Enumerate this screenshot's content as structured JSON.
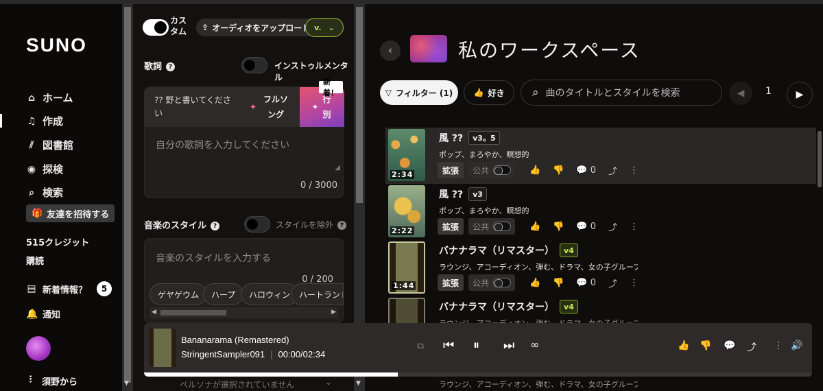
{
  "sidebar": {
    "logo": "SUNO",
    "items": [
      {
        "label": "ホーム",
        "icon": "home-icon"
      },
      {
        "label": "作成",
        "icon": "music-note-icon"
      },
      {
        "label": "図書館",
        "icon": "library-icon"
      },
      {
        "label": "探検",
        "icon": "compass-icon"
      },
      {
        "label": "検索",
        "icon": "search-icon"
      }
    ],
    "invite": "友達を招待する",
    "credits": "515クレジット",
    "subscribe": "購読",
    "news": "新着情報？",
    "news_count": "5",
    "notifications": "通知",
    "account": "須野から"
  },
  "create": {
    "custom_label": "カスタム",
    "upload_label": "オーディオをアップロード",
    "version_label": "v.",
    "lyrics_label": "歌詞",
    "instrumental_label": "インストゥルメンタル",
    "lyrics_prompt": "?? 野と書いてください",
    "full_song": "フルソング",
    "line_by_line": "行別",
    "new_tag": "新着！",
    "lyrics_placeholder": "自分の歌詞を入力してください",
    "lyrics_count": "0 / 3000",
    "style_label": "音楽のスタイル",
    "exclude_label": "スタイルを除外",
    "style_placeholder": "音楽のスタイルを入力する",
    "style_count": "0 / 200",
    "chips": [
      "ゲヤゲウム",
      "ハープ",
      "ハロウィン",
      "ハートランドI"
    ],
    "persona_placeholder": "ペルソナが選択されていません"
  },
  "workspace": {
    "title": "私のワークスペース",
    "filter": "フィルター (1)",
    "like": "好き",
    "search_placeholder": "曲のタイトルとスタイルを検索",
    "page": "1",
    "songs": [
      {
        "title": "風 ??",
        "version": "v3。5",
        "tags": "ポップ、まろやか、瞑想的",
        "duration": "2:34",
        "extend": "拡張",
        "public": "公共",
        "comments": "0"
      },
      {
        "title": "風 ??",
        "version": "v3",
        "tags": "ポップ、まろやか、瞑想的",
        "duration": "2:22",
        "extend": "拡張",
        "public": "公共",
        "comments": "0"
      },
      {
        "title": "バナナラマ（リマスター）",
        "version": "v4",
        "tags": "ラウンジ、アコーディオン、弾む、ドラマ、女の子グループ、サルサ",
        "duration": "1:44",
        "extend": "拡張",
        "public": "公共",
        "comments": "0"
      },
      {
        "title": "バナナラマ（リマスター）",
        "version": "v4",
        "tags": "ラウンジ、アコーディオン、弾む、ドラマ、女の子グループ、サルサ"
      }
    ]
  },
  "player": {
    "title": "Bananarama (Remastered)",
    "artist": "StringentSampler091",
    "time": "00:00/02:34",
    "progress": 0.38
  }
}
